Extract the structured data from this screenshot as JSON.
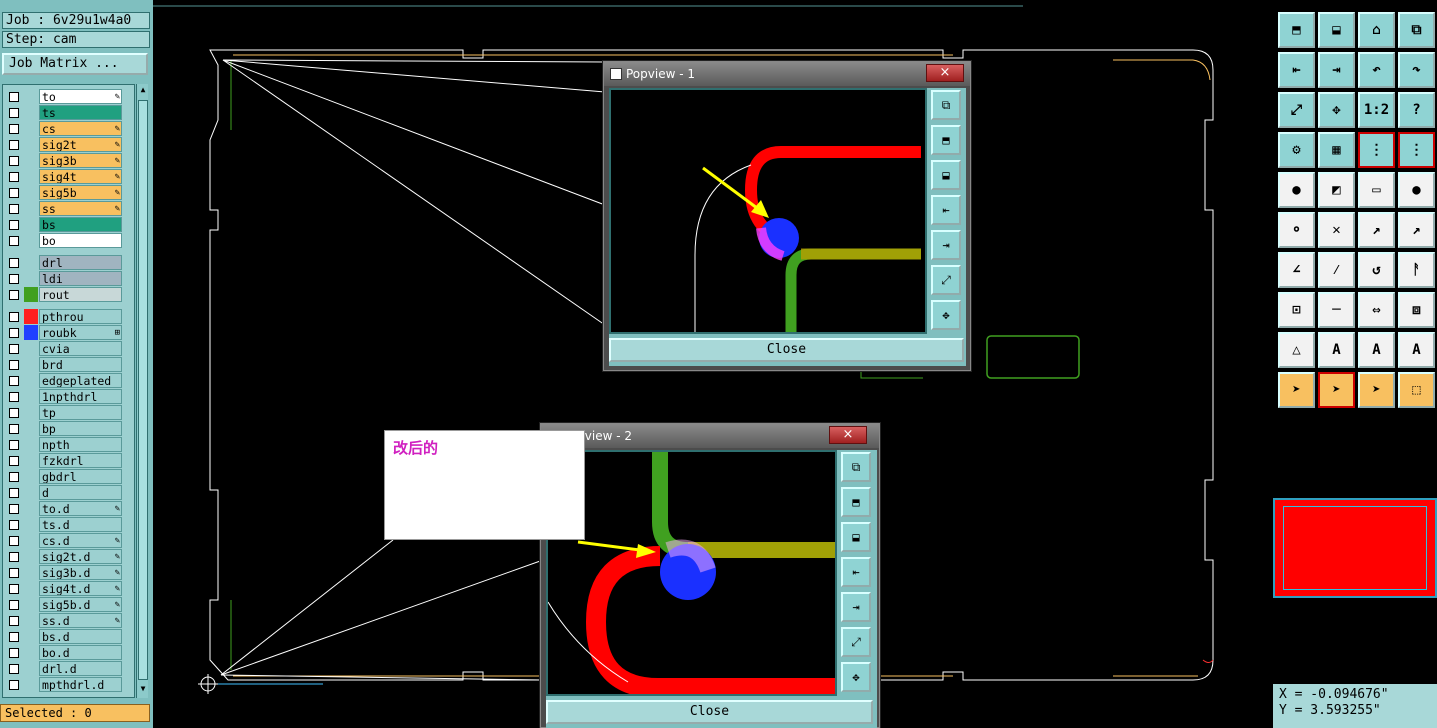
{
  "job_label": "Job : 6v29u1w4a0",
  "step_label": "Step: cam",
  "job_matrix_button": "Job Matrix ...",
  "layers": [
    {
      "name": "to",
      "color": "#ffffff",
      "mark": "✎"
    },
    {
      "name": "ts",
      "color": "#20a080",
      "mark": ""
    },
    {
      "name": "cs",
      "color": "#f8c060",
      "mark": "✎"
    },
    {
      "name": "sig2t",
      "color": "#f8c060",
      "mark": "✎"
    },
    {
      "name": "sig3b",
      "color": "#f8c060",
      "mark": "✎"
    },
    {
      "name": "sig4t",
      "color": "#f8c060",
      "mark": "✎"
    },
    {
      "name": "sig5b",
      "color": "#f8c060",
      "mark": "✎"
    },
    {
      "name": "ss",
      "color": "#f8c060",
      "mark": "✎"
    },
    {
      "name": "bs",
      "color": "#20a080",
      "mark": ""
    },
    {
      "name": "bo",
      "color": "#ffffff",
      "mark": ""
    },
    {
      "name": "drl",
      "color": "#a0b4c0",
      "mark": ""
    },
    {
      "name": "ldi",
      "color": "#a0b4c0",
      "mark": ""
    },
    {
      "name": "rout",
      "color": "#c8d8d8",
      "mark": ""
    },
    {
      "name": "pthrou",
      "color": "#9cd0d0",
      "mark": ""
    },
    {
      "name": "roubk",
      "color": "#9cd0d0",
      "mark": "⊞"
    },
    {
      "name": "cvia",
      "color": "#9cd0d0",
      "mark": ""
    },
    {
      "name": "brd",
      "color": "#9cd0d0",
      "mark": ""
    },
    {
      "name": "edgeplated",
      "color": "#9cd0d0",
      "mark": ""
    },
    {
      "name": "1npthdrl",
      "color": "#9cd0d0",
      "mark": ""
    },
    {
      "name": "tp",
      "color": "#9cd0d0",
      "mark": ""
    },
    {
      "name": "bp",
      "color": "#9cd0d0",
      "mark": ""
    },
    {
      "name": "npth",
      "color": "#9cd0d0",
      "mark": ""
    },
    {
      "name": "fzkdrl",
      "color": "#9cd0d0",
      "mark": ""
    },
    {
      "name": "gbdrl",
      "color": "#9cd0d0",
      "mark": ""
    },
    {
      "name": "d",
      "color": "#9cd0d0",
      "mark": ""
    },
    {
      "name": "to.d",
      "color": "#9cd0d0",
      "mark": "✎"
    },
    {
      "name": "ts.d",
      "color": "#9cd0d0",
      "mark": ""
    },
    {
      "name": "cs.d",
      "color": "#9cd0d0",
      "mark": "✎"
    },
    {
      "name": "sig2t.d",
      "color": "#9cd0d0",
      "mark": "✎"
    },
    {
      "name": "sig3b.d",
      "color": "#9cd0d0",
      "mark": "✎"
    },
    {
      "name": "sig4t.d",
      "color": "#9cd0d0",
      "mark": "✎"
    },
    {
      "name": "sig5b.d",
      "color": "#9cd0d0",
      "mark": "✎"
    },
    {
      "name": "ss.d",
      "color": "#9cd0d0",
      "mark": "✎"
    },
    {
      "name": "bs.d",
      "color": "#9cd0d0",
      "mark": ""
    },
    {
      "name": "bo.d",
      "color": "#9cd0d0",
      "mark": ""
    },
    {
      "name": "drl.d",
      "color": "#9cd0d0",
      "mark": ""
    },
    {
      "name": "mpthdrl.d",
      "color": "#9cd0d0",
      "mark": ""
    }
  ],
  "layer_swatches": {
    "rout": "#40a020",
    "pthrou": "#ff2020",
    "roubk": "#2040ff"
  },
  "selected_label": "Selected : 0",
  "popup1": {
    "title": "Popview - 1",
    "close_label": "Close",
    "close_x": "×"
  },
  "popup2": {
    "title": "Popview - 2",
    "close_label": "Close",
    "close_x": "×"
  },
  "note_text": "改后的",
  "coords": {
    "x": "X = -0.094676\"",
    "y": "Y = 3.593255\""
  },
  "toolbar_icons": [
    "snap-up-icon",
    "snap-down-icon",
    "home-icon",
    "zoom-window-icon",
    "pan-left-icon",
    "pan-right-icon",
    "undo-zoom-icon",
    "redo-zoom-icon",
    "zoom-fit-icon",
    "zoom-center-icon",
    "scale-1-2-icon",
    "help-icon",
    "measure-icon",
    "grid-icon",
    "layer-compare-icon",
    "layer-net-icon",
    "select-feature-icon",
    "select-area-icon",
    "ruler-icon",
    "pad-icon",
    "connect-icon",
    "delete-icon",
    "add-line-icon",
    "move-line-icon",
    "angle-icon",
    "slant-icon",
    "arc-icon",
    "mirror-icon",
    "copy-icon",
    "line-icon",
    "measure-dist-icon",
    "overlap-icon",
    "triangle-icon",
    "arrow-a-icon",
    "arrow-a2-icon",
    "arrow-a3-icon",
    "pointer-icon",
    "pointer-box-icon",
    "pointer-circle-icon",
    "route-icon"
  ],
  "toolbar_labels": {
    "scale": "1:2",
    "help": "?"
  }
}
